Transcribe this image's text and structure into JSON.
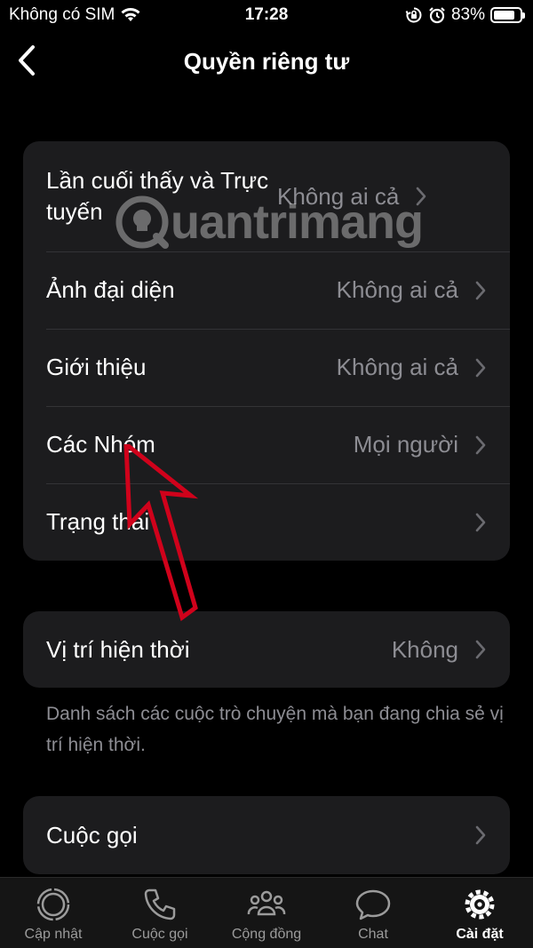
{
  "status_bar": {
    "carrier": "Không có SIM",
    "time": "17:28",
    "battery": "83%",
    "battery_level": 0.83
  },
  "nav": {
    "title": "Quyền riêng tư"
  },
  "privacy_group": [
    {
      "label": "Lần cuối thấy và Trực tuyến",
      "value": "Không ai cả"
    },
    {
      "label": "Ảnh đại diện",
      "value": "Không ai cả"
    },
    {
      "label": "Giới thiệu",
      "value": "Không ai cả"
    },
    {
      "label": "Các Nhóm",
      "value": "Mọi người"
    },
    {
      "label": "Trạng thái",
      "value": ""
    }
  ],
  "location_group": {
    "label": "Vị trí hiện thời",
    "value": "Không",
    "footnote": "Danh sách các cuộc trò chuyện mà bạn đang chia sẻ vị trí hiện thời."
  },
  "calls_group": {
    "label": "Cuộc gọi"
  },
  "watermark": "uantrimang",
  "tabs": [
    {
      "label": "Cập nhật",
      "icon": "updates-icon",
      "active": false
    },
    {
      "label": "Cuộc gọi",
      "icon": "phone-icon",
      "active": false
    },
    {
      "label": "Cộng đồng",
      "icon": "community-icon",
      "active": false
    },
    {
      "label": "Chat",
      "icon": "chat-icon",
      "active": false
    },
    {
      "label": "Cài đặt",
      "icon": "settings-gear-icon",
      "active": true
    }
  ],
  "colors": {
    "background": "#000000",
    "cell": "#1c1c1e",
    "secondary_text": "#8d8d93",
    "annotation_arrow": "#d0021b"
  }
}
